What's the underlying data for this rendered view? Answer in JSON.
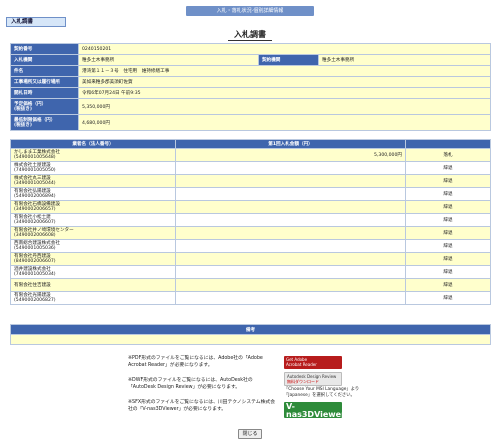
{
  "header": {
    "breadcrumb": "入札・落札状況-個別詳細情報",
    "tag_button": "入札調書",
    "page_title": "入札調書"
  },
  "info": {
    "contract_no_label": "契約番号",
    "contract_no": "0240150201",
    "bid_agency_label": "入札機関",
    "bid_agency": "稚多土木事務所",
    "contract_agency_label": "契約機関",
    "contract_agency": "稚多土木事務所",
    "project_label": "件名",
    "project": "港湾第１１－３号　住宅用　維持修繕工事",
    "location_label": "工事場所又は履行場所",
    "location": "美如来稚多郡美須町佐賀",
    "bid_date_label": "開札日時",
    "bid_date": "令和6年07月24日 午前9:35",
    "planned_price_label": "予定価格（円）",
    "planned_price_sub": "(税抜き)",
    "planned_price": "5,350,000円",
    "min_price_label": "最低制限価格（円）",
    "min_price_sub": "(税抜き)",
    "min_price": "4,680,000円"
  },
  "bids": {
    "col_company": "業者名（法人番号）",
    "col_amount": "第1回入札金額（円）",
    "col_result": "",
    "rows": [
      {
        "name": "かしまま工業株式会社",
        "number": "(5490001005648)",
        "amount": "5,300,000円",
        "result": "落札"
      },
      {
        "name": "株式会社土屋建設",
        "number": "(7490001005050)",
        "amount": "",
        "result": "辞退"
      },
      {
        "name": "株式会社丸三建設",
        "number": "(3490001005044)",
        "amount": "",
        "result": "辞退"
      },
      {
        "name": "有限会社弘陽建設",
        "number": "(5490002006894)",
        "amount": "",
        "result": "辞退"
      },
      {
        "name": "有限会社石橋設備建設",
        "number": "(3490002006657)",
        "amount": "",
        "result": "辞退"
      },
      {
        "name": "有限会社小松土建",
        "number": "(3490002006607)",
        "amount": "",
        "result": "辞退"
      },
      {
        "name": "有限会社井ノ崎環境センター",
        "number": "(3490002006608)",
        "amount": "",
        "result": "辞退"
      },
      {
        "name": "西南総合建設株式会社",
        "number": "(5490001005036)",
        "amount": "",
        "result": "辞退"
      },
      {
        "name": "有限会社丹西建設",
        "number": "(8490002006607)",
        "amount": "",
        "result": "辞退"
      },
      {
        "name": "酒井建設株式会社",
        "number": "(7490001005034)",
        "amount": "",
        "result": "辞退"
      },
      {
        "name": "有限会社住吉建設",
        "number": "",
        "amount": "",
        "result": "辞退"
      },
      {
        "name": "有限会社光陽建設",
        "number": "(5490002006827)",
        "amount": "",
        "result": "辞退"
      }
    ]
  },
  "remarks": {
    "label": "備考",
    "text": ""
  },
  "notes": {
    "pdf": "※PDF形式のファイルをご覧になるには、Adobe社の「Adobe Acrobat Reader」が必要になります。",
    "dwf": "※DWF形式のファイルをご覧になるには、AutoDesk社の「AutoDesk Design Review」が必要になります。",
    "sfx": "※SFX形式のファイルをご覧になるには、川田テクノシステム株式会社の「V-nas3DViewer」が必要になります。"
  },
  "badges": {
    "adobe_line1": "Get Adobe",
    "adobe_line2": "Acrobat Reader",
    "dwf_line1": "Autodesk Design Review",
    "dwf_line2": "無料ダウンロード",
    "dwf_note": "「Choose Your MSI Language」より「Japanese」を選択してください。",
    "vnas_line1": "V-nas3DViewer",
    "vnas_line2": "ダウンロードはこちら"
  },
  "footer": {
    "close_label": "閉じる"
  }
}
